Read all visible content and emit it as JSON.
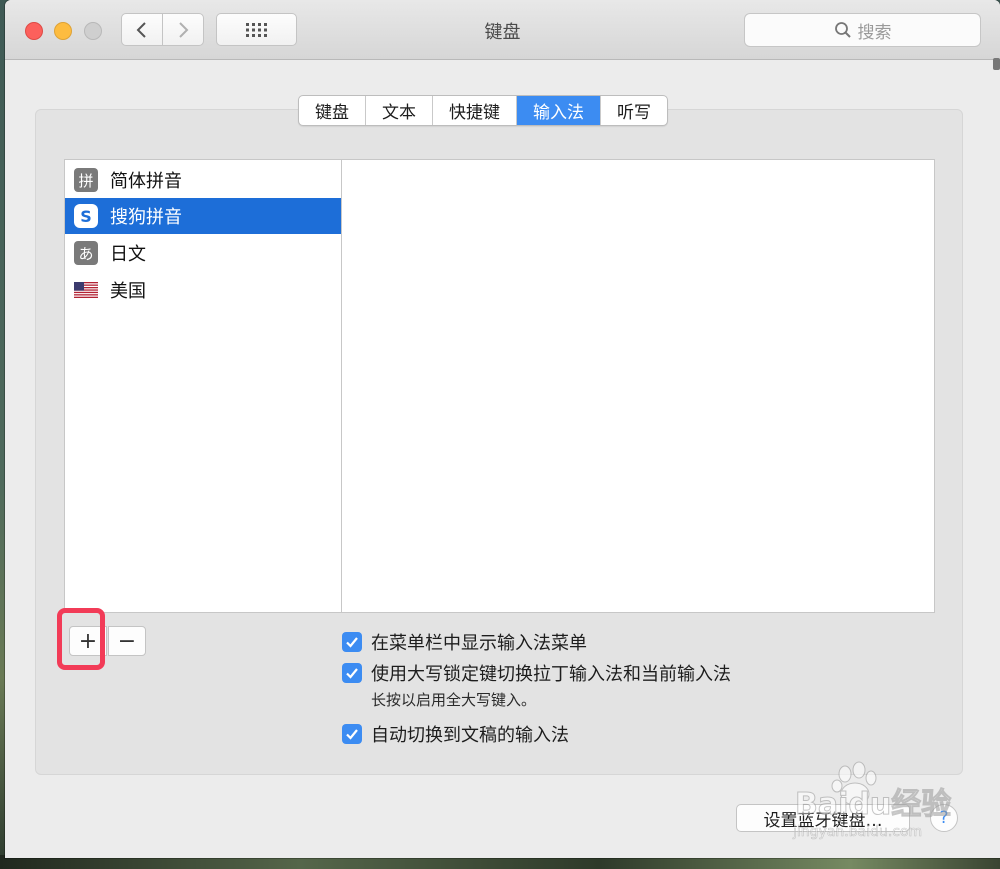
{
  "window": {
    "title": "键盘"
  },
  "search": {
    "placeholder": "搜索"
  },
  "tabs": [
    {
      "label": "键盘",
      "active": false
    },
    {
      "label": "文本",
      "active": false
    },
    {
      "label": "快捷键",
      "active": false
    },
    {
      "label": "输入法",
      "active": true
    },
    {
      "label": "听写",
      "active": false
    }
  ],
  "input_sources": [
    {
      "label": "简体拼音",
      "icon": "pinyin-icon",
      "glyph": "拼",
      "selected": false
    },
    {
      "label": "搜狗拼音",
      "icon": "sogou-icon",
      "glyph": "S",
      "selected": true
    },
    {
      "label": "日文",
      "icon": "hiragana-icon",
      "glyph": "あ",
      "selected": false
    },
    {
      "label": "美国",
      "icon": "us-flag-icon",
      "glyph": "",
      "selected": false
    }
  ],
  "list_controls": {
    "add": "+",
    "remove": "−"
  },
  "options": {
    "show_menu": {
      "label": "在菜单栏中显示输入法菜单",
      "checked": true
    },
    "caps_lock": {
      "label": "使用大写锁定键切换拉丁输入法和当前输入法",
      "checked": true,
      "hint": "长按以启用全大写键入。"
    },
    "auto_switch": {
      "label": "自动切换到文稿的输入法",
      "checked": true
    }
  },
  "footer": {
    "bluetooth_button": "设置蓝牙键盘…",
    "help_button": "?"
  },
  "watermark": {
    "text": "Baidu经验",
    "url_text": "jingyan.baidu.com"
  },
  "colors": {
    "accent": "#3c8cf2",
    "selection": "#1d6ed8",
    "highlight_box": "#f23b57"
  }
}
